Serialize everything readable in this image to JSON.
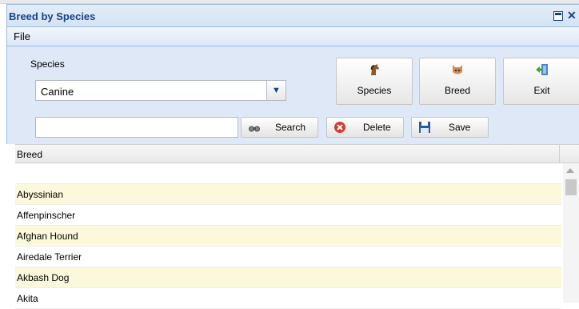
{
  "window": {
    "title": "Breed by Species"
  },
  "menu": {
    "file_label": "File"
  },
  "species": {
    "label": "Species",
    "selected": "Canine"
  },
  "toolbar": {
    "species_label": "Species",
    "breed_label": "Breed",
    "exit_label": "Exit"
  },
  "search": {
    "value": "",
    "search_label": "Search",
    "delete_label": "Delete",
    "save_label": "Save"
  },
  "grid": {
    "column": "Breed",
    "rows": [
      "",
      "Abyssinian",
      "Affenpinscher",
      "Afghan Hound",
      "Airedale Terrier",
      "Akbash Dog",
      "Akita"
    ]
  },
  "colors": {
    "title": "#15428b",
    "panel": "#dfe8f6",
    "alt_row": "#fbf8dc"
  }
}
